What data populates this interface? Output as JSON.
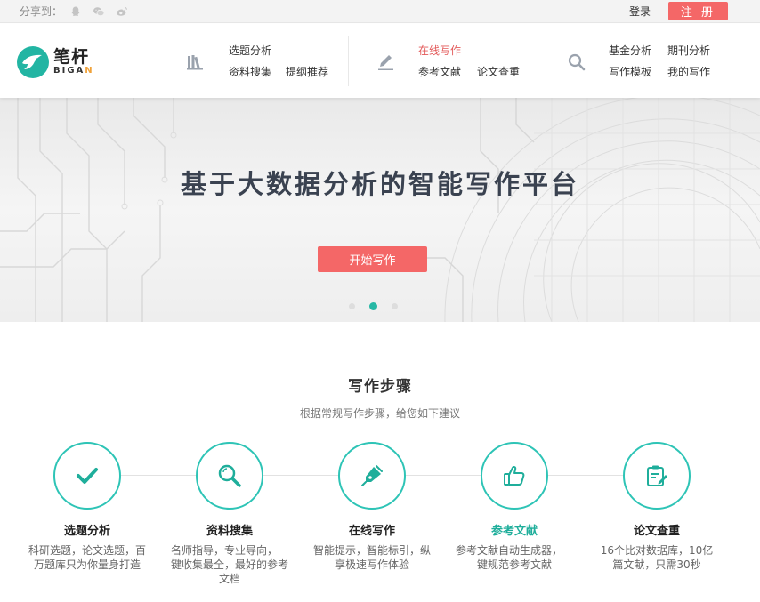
{
  "topbar": {
    "share_label": "分享到：",
    "share_icons": [
      "qq-icon",
      "wechat-icon",
      "weibo-icon"
    ],
    "login_label": "登录",
    "register_label": "注 册"
  },
  "logo": {
    "cn": "笔杆",
    "en_main": "BIGA",
    "en_accent": "N"
  },
  "nav": {
    "group1": {
      "icon": "books-icon",
      "links": [
        "选题分析",
        "资料搜集",
        "提纲推荐"
      ]
    },
    "group2": {
      "icon": "pen-icon",
      "links": [
        "在线写作",
        "参考文献",
        "论文查重"
      ]
    },
    "group3": {
      "icon": "search-icon",
      "links": [
        "基金分析",
        "期刊分析",
        "写作模板",
        "我的写作"
      ]
    }
  },
  "banner": {
    "title": "基于大数据分析的智能写作平台",
    "button": "开始写作",
    "slides": 3,
    "active_slide": 2
  },
  "steps_section": {
    "title": "写作步骤",
    "subtitle": "根据常规写作步骤，给您如下建议",
    "steps": [
      {
        "icon": "checkmark-icon",
        "title": "选题分析",
        "desc": "科研选题，论文选题，百万题库只为你量身打造"
      },
      {
        "icon": "magnifier-icon",
        "title": "资料搜集",
        "desc": "名师指导，专业导向，一键收集最全，最好的参考文档"
      },
      {
        "icon": "fountain-pen-icon",
        "title": "在线写作",
        "desc": "智能提示，智能标引，纵享极速写作体验"
      },
      {
        "icon": "thumbs-up-icon",
        "title": "参考文献",
        "desc": "参考文献自动生成器，一键规范参考文献"
      },
      {
        "icon": "clipboard-edit-icon",
        "title": "论文查重",
        "desc": "16个比对数据库，10亿篇文献，只需30秒"
      }
    ]
  },
  "colors": {
    "accent_red": "#f46767",
    "accent_teal": "#2ec4b6",
    "active_nav": "#e35b5b"
  }
}
